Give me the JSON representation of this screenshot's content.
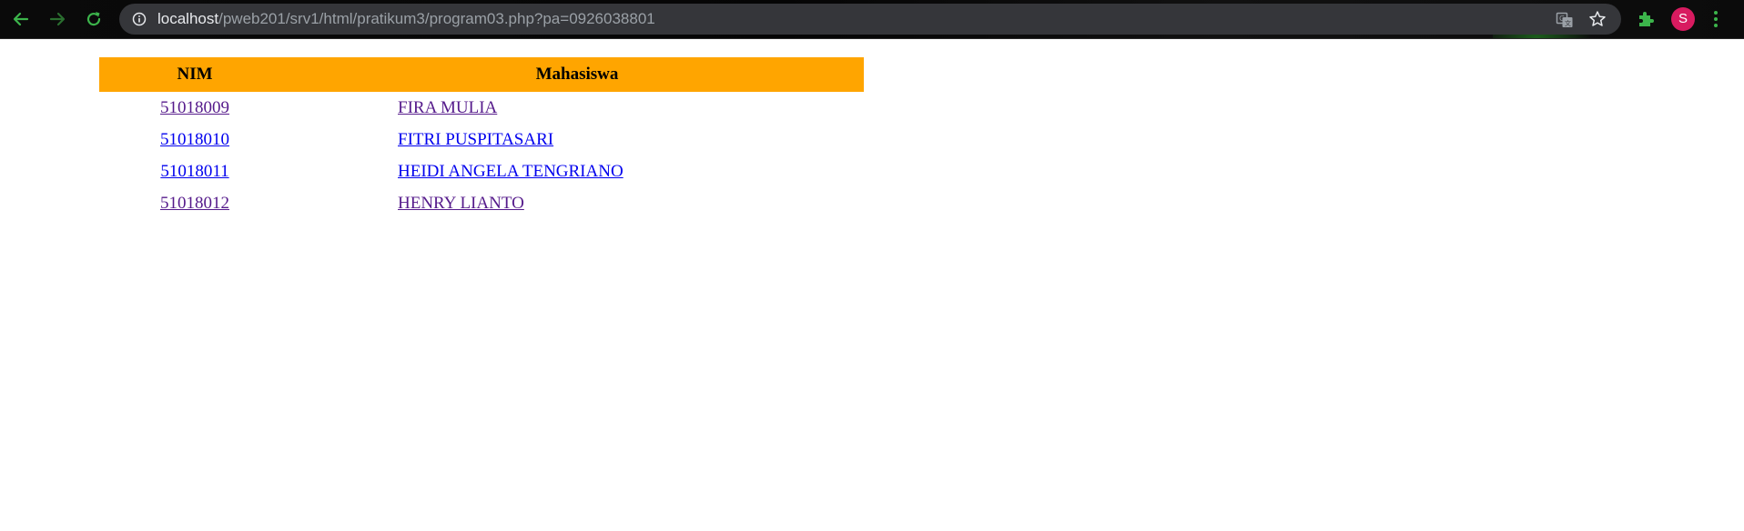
{
  "browser": {
    "url_host": "localhost",
    "url_path": "/pweb201/srv1/html/pratikum3/program03.php?pa=0926038801",
    "profile_initial": "S",
    "colors": {
      "accent_green": "#3cb44b",
      "avatar_bg": "#d81b60",
      "omnibox_bg": "#35363a"
    }
  },
  "table": {
    "header_bg": "#ffa500",
    "headers": {
      "nim": "NIM",
      "mahasiswa": "Mahasiswa"
    },
    "rows": [
      {
        "nim": "51018009",
        "name": "FIRA MULIA",
        "visited": true
      },
      {
        "nim": "51018010",
        "name": "FITRI PUSPITASARI",
        "visited": false
      },
      {
        "nim": "51018011",
        "name": "HEIDI ANGELA TENGRIANO",
        "visited": false
      },
      {
        "nim": "51018012",
        "name": "HENRY LIANTO",
        "visited": true
      }
    ]
  }
}
